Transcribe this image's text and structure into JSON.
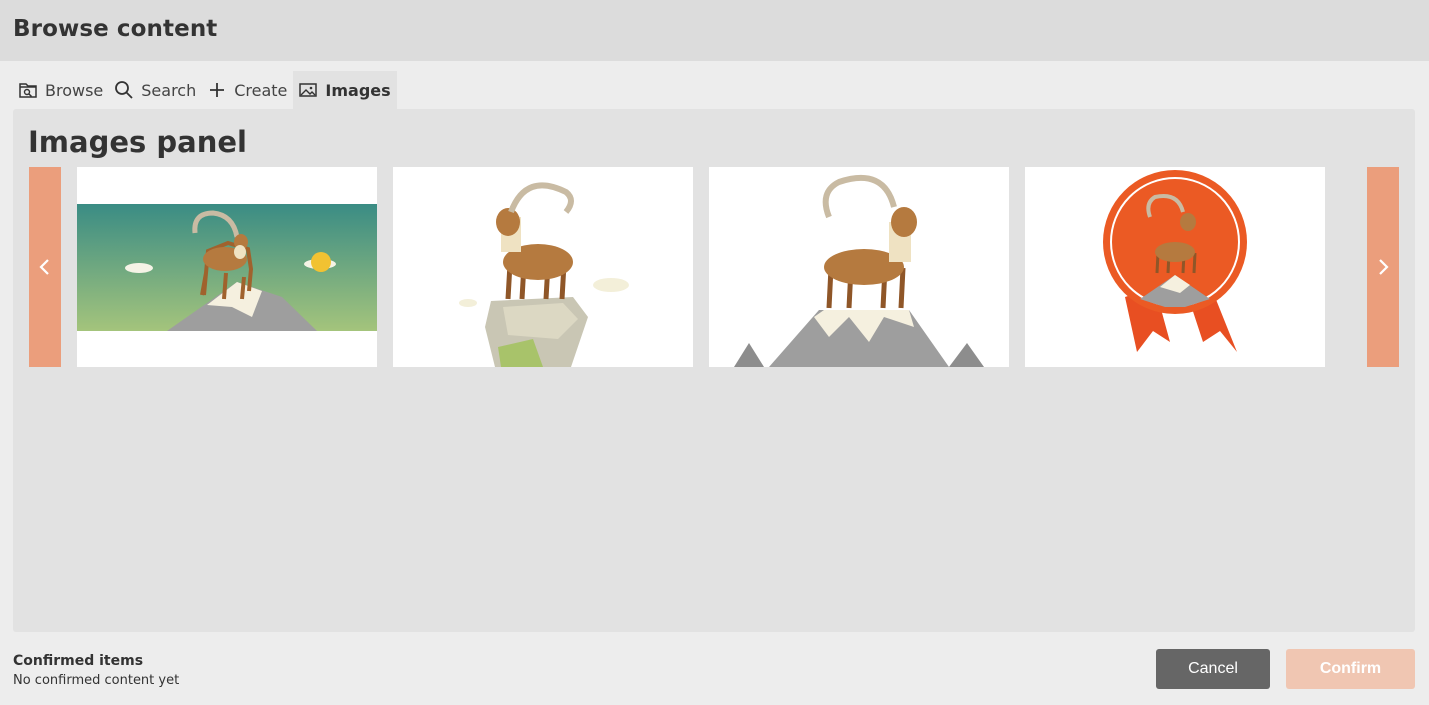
{
  "header": {
    "title": "Browse content"
  },
  "tabs": [
    {
      "label": "Browse",
      "icon": "folder-search-icon"
    },
    {
      "label": "Search",
      "icon": "search-icon"
    },
    {
      "label": "Create",
      "icon": "plus-icon"
    },
    {
      "label": "Images",
      "icon": "image-icon",
      "active": true
    }
  ],
  "panel": {
    "title": "Images panel",
    "images": [
      {
        "alt": "Ibex on mountain with sky background"
      },
      {
        "alt": "Ibex standing on rock"
      },
      {
        "alt": "Ibex on grey mountain peak"
      },
      {
        "alt": "Ibex on orange badge with ribbons"
      }
    ]
  },
  "footer": {
    "confirmed_label": "Confirmed items",
    "confirmed_empty": "No confirmed content yet",
    "cancel_label": "Cancel",
    "confirm_label": "Confirm"
  },
  "colors": {
    "accent": "#eb9e7c",
    "confirm_disabled": "#f0c6b2",
    "cancel": "#666666"
  }
}
